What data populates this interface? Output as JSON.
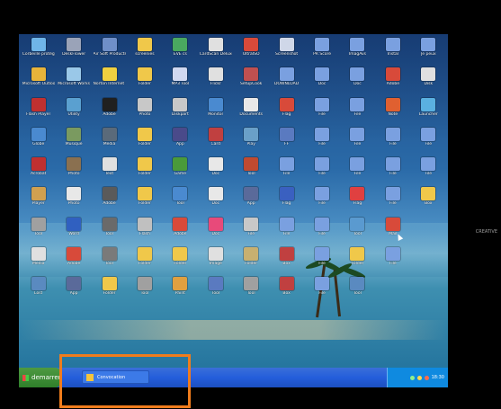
{
  "desktop": {
    "icons": [
      {
        "label": "Corbeille protégée",
        "color": "#6fb5e8"
      },
      {
        "label": "DeskFlower",
        "color": "#9aa3b8"
      },
      {
        "label": "Air Soft Products",
        "color": "#6f8fc8"
      },
      {
        "label": "screenies",
        "color": "#f0c84a"
      },
      {
        "label": "EVE cs",
        "color": "#4aa860"
      },
      {
        "label": "CardScan Deluxe 8.0",
        "color": "#e0e0e0"
      },
      {
        "label": "UltraISO",
        "color": "#d84a3a"
      },
      {
        "label": "Screenshot",
        "color": "#cfd7e8"
      },
      {
        "label": "PR Score",
        "color": "#7aa0e0"
      },
      {
        "label": "ImagAvs",
        "color": "#7aa0e0"
      },
      {
        "label": "Instal",
        "color": "#7aa0e0"
      },
      {
        "label": "Je peux",
        "color": "#7aa0e0"
      },
      {
        "label": "Microsoft Outlook",
        "color": "#e8b43a"
      },
      {
        "label": "Microsoft Works",
        "color": "#9ac8e8"
      },
      {
        "label": "Norton Internet Security",
        "color": "#f0d040"
      },
      {
        "label": "Folder",
        "color": "#f0c84a"
      },
      {
        "label": "MP3 Tool",
        "color": "#d0d8f0"
      },
      {
        "label": "Flickr",
        "color": "#e0e0e0"
      },
      {
        "label": "SetupCook",
        "color": "#c05050"
      },
      {
        "label": "DOWNLOAD",
        "color": "#7aa0e0"
      },
      {
        "label": "Doc",
        "color": "#7aa0e0"
      },
      {
        "label": "Doc",
        "color": "#7aa0e0"
      },
      {
        "label": "Adobe",
        "color": "#d84a3a"
      },
      {
        "label": "Disk",
        "color": "#e0e0e0"
      },
      {
        "label": "Flash Player",
        "color": "#c03030"
      },
      {
        "label": "Utility",
        "color": "#5aa0d0"
      },
      {
        "label": "Adobe",
        "color": "#202020"
      },
      {
        "label": "Photo",
        "color": "#c8c8c8"
      },
      {
        "label": "Diskpart",
        "color": "#c8c8c8"
      },
      {
        "label": "Monitor",
        "color": "#4a8ad0"
      },
      {
        "label": "Documents",
        "color": "#e8e8e8"
      },
      {
        "label": "Flag",
        "color": "#d84a3a"
      },
      {
        "label": "File",
        "color": "#7aa0e0"
      },
      {
        "label": "File",
        "color": "#7aa0e0"
      },
      {
        "label": "Note",
        "color": "#e06030"
      },
      {
        "label": "Launcher",
        "color": "#5ab0e0"
      },
      {
        "label": "Globe",
        "color": "#4a8ad0"
      },
      {
        "label": "Musique",
        "color": "#7a9a60"
      },
      {
        "label": "Media",
        "color": "#5a6a7a"
      },
      {
        "label": "Folder",
        "color": "#f0c84a"
      },
      {
        "label": "App",
        "color": "#4a4a8a"
      },
      {
        "label": "Card",
        "color": "#c04040"
      },
      {
        "label": "Play",
        "color": "#6aa0c8"
      },
      {
        "label": "FF",
        "color": "#5a7ac0"
      },
      {
        "label": "File",
        "color": "#7aa0e0"
      },
      {
        "label": "File",
        "color": "#7aa0e0"
      },
      {
        "label": "File",
        "color": "#7aa0e0"
      },
      {
        "label": "File",
        "color": "#7aa0e0"
      },
      {
        "label": "Acrobat",
        "color": "#c03030"
      },
      {
        "label": "Photo",
        "color": "#8a7050"
      },
      {
        "label": "Text",
        "color": "#e0e0e0"
      },
      {
        "label": "Folder",
        "color": "#f0c84a"
      },
      {
        "label": "Game",
        "color": "#4a9a3a"
      },
      {
        "label": "Doc",
        "color": "#e8e8e8"
      },
      {
        "label": "Tool",
        "color": "#c04a30"
      },
      {
        "label": "File",
        "color": "#7aa0e0"
      },
      {
        "label": "File",
        "color": "#7aa0e0"
      },
      {
        "label": "File",
        "color": "#7aa0e0"
      },
      {
        "label": "File",
        "color": "#7aa0e0"
      },
      {
        "label": "File",
        "color": "#7aa0e0"
      },
      {
        "label": "Player",
        "color": "#d0a050"
      },
      {
        "label": "Photo",
        "color": "#e8e8e8"
      },
      {
        "label": "Adobe",
        "color": "#5a5a5a"
      },
      {
        "label": "Folder",
        "color": "#f0c84a"
      },
      {
        "label": "Tool",
        "color": "#4a8ad0"
      },
      {
        "label": "Doc",
        "color": "#e8e8e8"
      },
      {
        "label": "App",
        "color": "#5a6a9a"
      },
      {
        "label": "Flag",
        "color": "#3a60c0"
      },
      {
        "label": "File",
        "color": "#7aa0e0"
      },
      {
        "label": "Flag",
        "color": "#e04040"
      },
      {
        "label": "File",
        "color": "#7aa0e0"
      },
      {
        "label": "Box",
        "color": "#f0c84a"
      },
      {
        "label": "Tool",
        "color": "#a0a0a0"
      },
      {
        "label": "Word",
        "color": "#3060c0"
      },
      {
        "label": "Tool",
        "color": "#6a6a6a"
      },
      {
        "label": "Flash",
        "color": "#c0c0c0"
      },
      {
        "label": "Adobe",
        "color": "#d84a3a"
      },
      {
        "label": "Doc",
        "color": "#e84a7a"
      },
      {
        "label": "File",
        "color": "#c8c8c8"
      },
      {
        "label": "File",
        "color": "#7aa0e0"
      },
      {
        "label": "File",
        "color": "#7aa0e0"
      },
      {
        "label": "Tool",
        "color": "#5a9ad0"
      },
      {
        "label": "Mail",
        "color": "#d84a3a"
      },
      {
        "label": "",
        "color": "transparent"
      },
      {
        "label": "Media",
        "color": "#e0e0e0"
      },
      {
        "label": "Adobe",
        "color": "#d84a3a"
      },
      {
        "label": "Tool",
        "color": "#7a7a7a"
      },
      {
        "label": "Folder",
        "color": "#f0c84a"
      },
      {
        "label": "Folder",
        "color": "#f0c84a"
      },
      {
        "label": "Image",
        "color": "#e0e0e0"
      },
      {
        "label": "Folder",
        "color": "#c8b070"
      },
      {
        "label": "Box",
        "color": "#c04040"
      },
      {
        "label": "File",
        "color": "#7aa0e0"
      },
      {
        "label": "Folder",
        "color": "#f0c84a"
      },
      {
        "label": "File",
        "color": "#7aa0e0"
      },
      {
        "label": "",
        "color": "transparent"
      },
      {
        "label": "Lost",
        "color": "#5a8ac0"
      },
      {
        "label": "App",
        "color": "#5a6a9a"
      },
      {
        "label": "Folder",
        "color": "#f0c84a"
      },
      {
        "label": "Tool",
        "color": "#a0a0a0"
      },
      {
        "label": "Paint",
        "color": "#e0a040"
      },
      {
        "label": "Tool",
        "color": "#5a7ac0"
      },
      {
        "label": "Tool",
        "color": "#a0a0a0"
      },
      {
        "label": "Box",
        "color": "#c04040"
      },
      {
        "label": "File",
        "color": "#7aa0e0"
      },
      {
        "label": "Tool",
        "color": "#5a8ac0"
      },
      {
        "label": "",
        "color": "transparent"
      },
      {
        "label": "",
        "color": "transparent"
      }
    ]
  },
  "taskbar": {
    "start_label": "demarrer",
    "buttons": [
      {
        "label": "Convocation"
      }
    ],
    "tray": {
      "clock": "18:30"
    }
  },
  "overlay": {
    "watermark": "CREATIVE",
    "highlight_color": "#f07c1c"
  }
}
